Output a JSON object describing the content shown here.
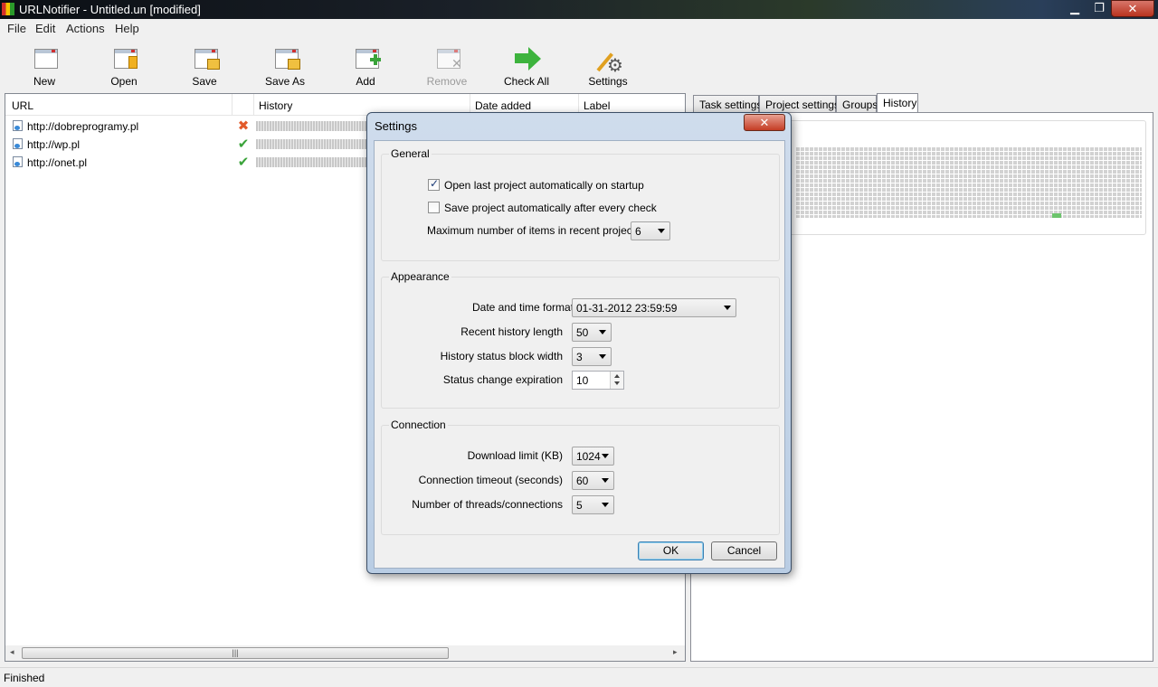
{
  "window": {
    "title": "URLNotifier - Untitled.un [modified]",
    "min_glyph": "▁",
    "max_glyph": "❐",
    "close_glyph": "✕"
  },
  "menu": [
    "File",
    "Edit",
    "Actions",
    "Help"
  ],
  "toolbar": [
    {
      "label": "New",
      "icon": "new-document-icon",
      "enabled": true
    },
    {
      "label": "Open",
      "icon": "open-folder-icon",
      "enabled": true
    },
    {
      "label": "Save",
      "icon": "save-icon",
      "enabled": true
    },
    {
      "label": "Save As",
      "icon": "save-as-icon",
      "enabled": true
    },
    {
      "label": "Add",
      "icon": "add-icon",
      "enabled": true
    },
    {
      "label": "Remove",
      "icon": "remove-icon",
      "enabled": false
    },
    {
      "label": "Check All",
      "icon": "check-all-arrow-icon",
      "enabled": true
    },
    {
      "label": "Settings",
      "icon": "settings-gear-icon",
      "enabled": true
    }
  ],
  "list": {
    "columns": [
      "URL",
      "History",
      "Date added",
      "Label"
    ],
    "rows": [
      {
        "url": "http://dobreprogramy.pl",
        "status": "error",
        "status_glyph": "✖",
        "status_color": "#e25a2a"
      },
      {
        "url": "http://wp.pl",
        "status": "ok",
        "status_glyph": "✔",
        "status_color": "#3aa33a"
      },
      {
        "url": "http://onet.pl",
        "status": "ok",
        "status_glyph": "✔",
        "status_color": "#3aa33a"
      }
    ],
    "hscroll_grip": "|||",
    "scroll_left": "◂",
    "scroll_right": "▸"
  },
  "tabs": [
    {
      "label": "Task settings",
      "active": false
    },
    {
      "label": "Project settings",
      "active": false
    },
    {
      "label": "Groups",
      "active": false
    },
    {
      "label": "History",
      "active": true
    }
  ],
  "status": "Finished",
  "dialog": {
    "title": "Settings",
    "close_glyph": "✕",
    "general": {
      "title": "General",
      "open_last": {
        "label": "Open last project automatically on startup",
        "checked": true
      },
      "save_auto": {
        "label": "Save project automatically after every check",
        "checked": false
      },
      "max_recent": {
        "label": "Maximum number of items in recent project list",
        "value": "6"
      }
    },
    "appearance": {
      "title": "Appearance",
      "date_format": {
        "label": "Date and time format",
        "value": "01-31-2012 23:59:59"
      },
      "history_length": {
        "label": "Recent history length",
        "value": "50"
      },
      "block_width": {
        "label": "History status block width",
        "value": "3"
      },
      "expiration": {
        "label": "Status change expiration",
        "value": "10"
      }
    },
    "connection": {
      "title": "Connection",
      "download_limit": {
        "label": "Download limit (KB)",
        "value": "1024"
      },
      "timeout": {
        "label": "Connection timeout (seconds)",
        "value": "60"
      },
      "threads": {
        "label": "Number of threads/connections",
        "value": "5"
      }
    },
    "ok": "OK",
    "cancel": "Cancel"
  }
}
